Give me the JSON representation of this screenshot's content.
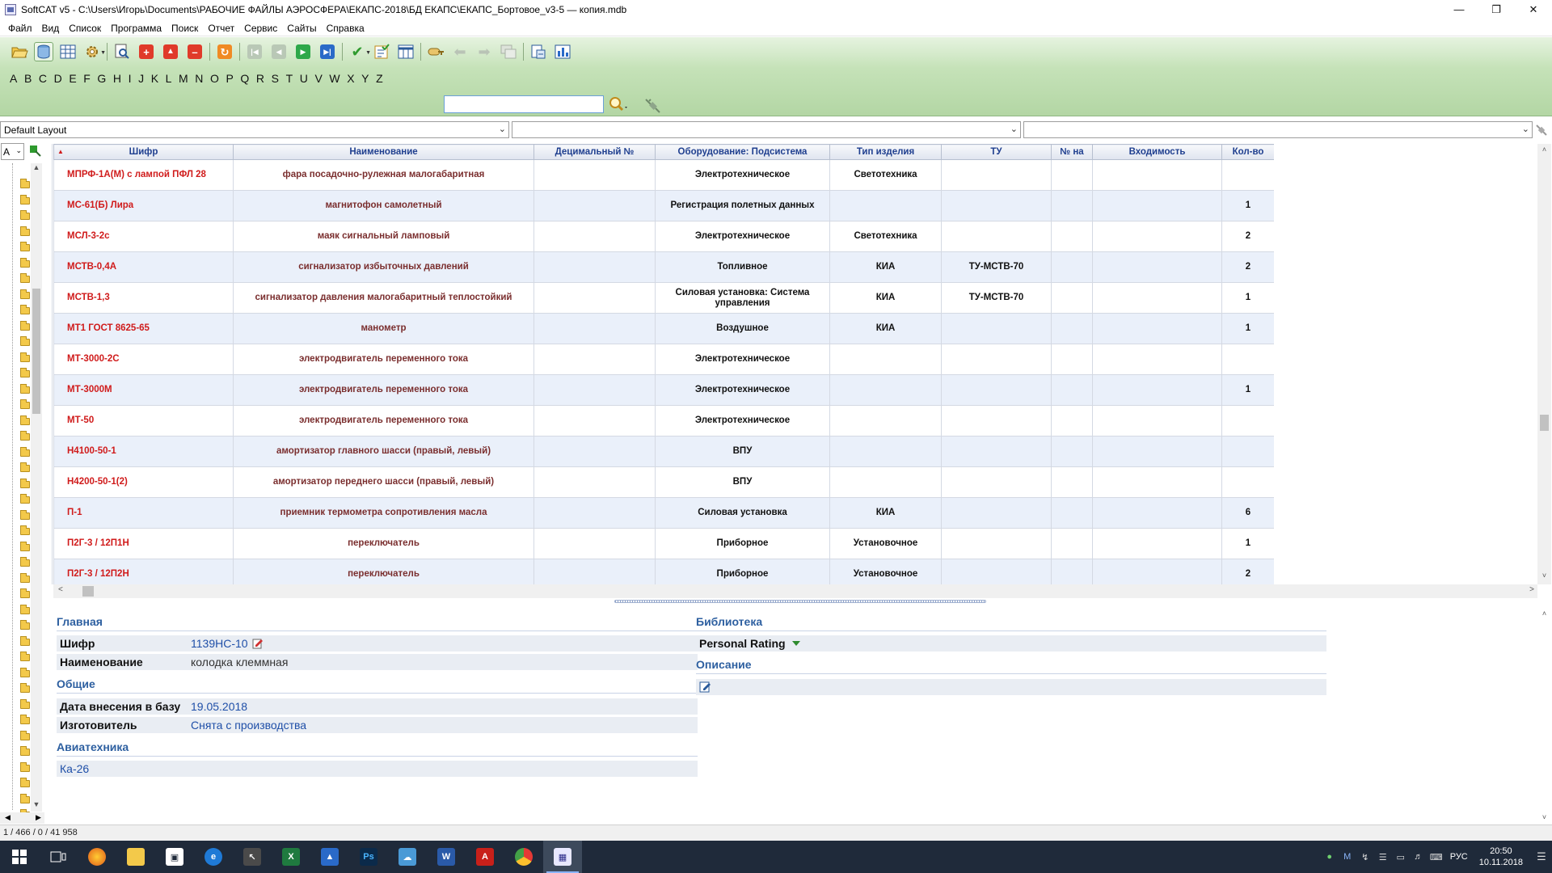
{
  "window": {
    "title": "SoftCAT v5 - C:\\Users\\Игорь\\Documents\\РАБОЧИЕ ФАЙЛЫ АЭРОСФЕРА\\ЕКАПС-2018\\БД ЕКАПС\\ЕКАПС_Бортовое_v3-5 — копия.mdb"
  },
  "menu": [
    "Файл",
    "Вид",
    "Список",
    "Программа",
    "Поиск",
    "Отчет",
    "Сервис",
    "Сайты",
    "Справка"
  ],
  "alphabet": [
    "A",
    "B",
    "C",
    "D",
    "E",
    "F",
    "G",
    "H",
    "I",
    "J",
    "K",
    "L",
    "M",
    "N",
    "O",
    "P",
    "Q",
    "R",
    "S",
    "T",
    "U",
    "V",
    "W",
    "X",
    "Y",
    "Z"
  ],
  "search": {
    "value": ""
  },
  "layouts": {
    "layout": "Default Layout",
    "combo2": "",
    "combo3": ""
  },
  "tree": {
    "letter": "A"
  },
  "grid": {
    "columns": [
      "Шифр",
      "Наименование",
      "Децимальный №",
      "Оборудование: Подсистема",
      "Тип изделия",
      "ТУ",
      "№ на",
      "Входимость",
      "Кол-во"
    ],
    "rows": [
      {
        "code": "МПРФ-1А(М) с лампой ПФЛ 28",
        "name": "фара посадочно-рулежная малогабаритная",
        "decimal": "",
        "subsystem": "Электротехническое",
        "type": "Светотехника",
        "tu": "",
        "num": "",
        "inclusion": "",
        "qty": ""
      },
      {
        "code": "МС-61(Б) Лира",
        "name": "магнитофон самолетный",
        "decimal": "",
        "subsystem": "Регистрация полетных данных",
        "type": "",
        "tu": "",
        "num": "",
        "inclusion": "",
        "qty": "1"
      },
      {
        "code": "МСЛ-3-2с",
        "name": "маяк сигнальный ламповый",
        "decimal": "",
        "subsystem": "Электротехническое",
        "type": "Светотехника",
        "tu": "",
        "num": "",
        "inclusion": "",
        "qty": "2"
      },
      {
        "code": "МСТВ-0,4А",
        "name": "сигнализатор избыточных давлений",
        "decimal": "",
        "subsystem": "Топливное",
        "type": "КИА",
        "tu": "ТУ-МСТВ-70",
        "num": "",
        "inclusion": "",
        "qty": "2"
      },
      {
        "code": "МСТВ-1,3",
        "name": "сигнализатор давления малогабаритный теплостойкий",
        "decimal": "",
        "subsystem": "Силовая установка: Система управления",
        "type": "КИА",
        "tu": "ТУ-МСТВ-70",
        "num": "",
        "inclusion": "",
        "qty": "1"
      },
      {
        "code": "МТ1 ГОСТ 8625-65",
        "name": "манометр",
        "decimal": "",
        "subsystem": "Воздушное",
        "type": "КИА",
        "tu": "",
        "num": "",
        "inclusion": "",
        "qty": "1"
      },
      {
        "code": "МТ-3000-2С",
        "name": "электродвигатель переменного тока",
        "decimal": "",
        "subsystem": "Электротехническое",
        "type": "",
        "tu": "",
        "num": "",
        "inclusion": "",
        "qty": ""
      },
      {
        "code": "МТ-3000М",
        "name": "электродвигатель переменного тока",
        "decimal": "",
        "subsystem": "Электротехническое",
        "type": "",
        "tu": "",
        "num": "",
        "inclusion": "",
        "qty": "1"
      },
      {
        "code": "МТ-50",
        "name": "электродвигатель переменного тока",
        "decimal": "",
        "subsystem": "Электротехническое",
        "type": "",
        "tu": "",
        "num": "",
        "inclusion": "",
        "qty": ""
      },
      {
        "code": "Н4100-50-1",
        "name": "амортизатор главного шасси (правый, левый)",
        "decimal": "",
        "subsystem": "ВПУ",
        "type": "",
        "tu": "",
        "num": "",
        "inclusion": "",
        "qty": ""
      },
      {
        "code": "Н4200-50-1(2)",
        "name": "амортизатор переднего шасси (правый, левый)",
        "decimal": "",
        "subsystem": "ВПУ",
        "type": "",
        "tu": "",
        "num": "",
        "inclusion": "",
        "qty": ""
      },
      {
        "code": "П-1",
        "name": "приемник термометра сопротивления масла",
        "decimal": "",
        "subsystem": "Силовая установка",
        "type": "КИА",
        "tu": "",
        "num": "",
        "inclusion": "",
        "qty": "6"
      },
      {
        "code": "П2Г-3 / 12П1Н",
        "name": "переключатель",
        "decimal": "",
        "subsystem": "Приборное",
        "type": "Установочное",
        "tu": "",
        "num": "",
        "inclusion": "",
        "qty": "1"
      },
      {
        "code": "П2Г-3 / 12П2Н",
        "name": "переключатель",
        "decimal": "",
        "subsystem": "Приборное",
        "type": "Установочное",
        "tu": "",
        "num": "",
        "inclusion": "",
        "qty": "2"
      }
    ]
  },
  "detail": {
    "main": {
      "title": "Главная",
      "code_label": "Шифр",
      "code_value": "1139НС-10",
      "name_label": "Наименование",
      "name_value": "колодка клеммная"
    },
    "general": {
      "title": "Общие",
      "date_label": "Дата внесения в базу",
      "date_value": "19.05.2018",
      "maker_label": "Изготовитель",
      "maker_value": "Снята с производства"
    },
    "aviation": {
      "title": "Авиатехника",
      "value": "Ка-26"
    },
    "library": {
      "title": "Библиотека",
      "rating": "Personal Rating"
    },
    "description": {
      "title": "Описание"
    }
  },
  "status": {
    "text": "1 / 466 / 0 / 41 958"
  },
  "taskbar": {
    "lang": "РУС",
    "time": "20:50",
    "date": "10.11.2018"
  }
}
